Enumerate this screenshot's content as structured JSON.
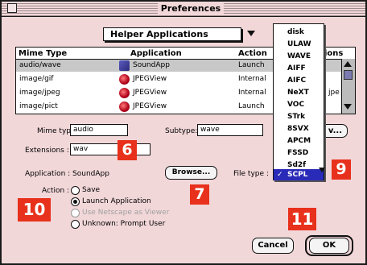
{
  "window": {
    "title": "Preferences"
  },
  "category_popup": "Helper Applications",
  "table": {
    "headers": {
      "mime_type": "Mime Type",
      "application": "Application",
      "action": "Action",
      "extensions": "ions"
    },
    "rows": [
      {
        "mime": "audio/wave",
        "app": "SoundApp",
        "action": "Launch",
        "ext": ""
      },
      {
        "mime": "image/gif",
        "app": "JPEGView",
        "action": "Internal",
        "ext": ""
      },
      {
        "mime": "image/jpeg",
        "app": "JPEGView",
        "action": "Internal",
        "ext": "jpe"
      },
      {
        "mime": "image/pict",
        "app": "JPEGView",
        "action": "Launch",
        "ext": ""
      }
    ]
  },
  "form": {
    "mime_type_label": "Mime type:",
    "mime_type_value": "audio",
    "subtype_label": "Subtype:",
    "subtype_value": "wave",
    "extensions_label": "Extensions :",
    "extensions_value": "wav",
    "application_label": "Application : SoundApp",
    "browse_label": "Browse...",
    "file_type_label": "File type :",
    "partial_button": "v...",
    "action_label": "Action :",
    "actions": [
      {
        "label": "Save",
        "selected": false,
        "disabled": false
      },
      {
        "label": "Launch Application",
        "selected": true,
        "disabled": false
      },
      {
        "label": "Use Netscape as Viewer",
        "selected": false,
        "disabled": true
      },
      {
        "label": "Unknown: Prompt User",
        "selected": false,
        "disabled": false
      }
    ]
  },
  "file_type_menu": {
    "items": [
      "disk",
      "ULAW",
      "WAVE",
      "AIFF",
      "AIFC",
      "NeXT",
      "VOC",
      "STrk",
      "8SVX",
      "APCM",
      "FSSD",
      "Sd2f",
      "SCPL"
    ],
    "selected": "SCPL",
    "checkmark": "✓"
  },
  "buttons": {
    "cancel": "Cancel",
    "ok": "OK"
  },
  "callouts": {
    "c6": "6",
    "c7": "7",
    "c9": "9",
    "c10": "10",
    "c11": "11"
  },
  "colors": {
    "callout": "#e8311c",
    "menu_highlight": "#2a2ab8",
    "background": "#f2d7d9"
  }
}
